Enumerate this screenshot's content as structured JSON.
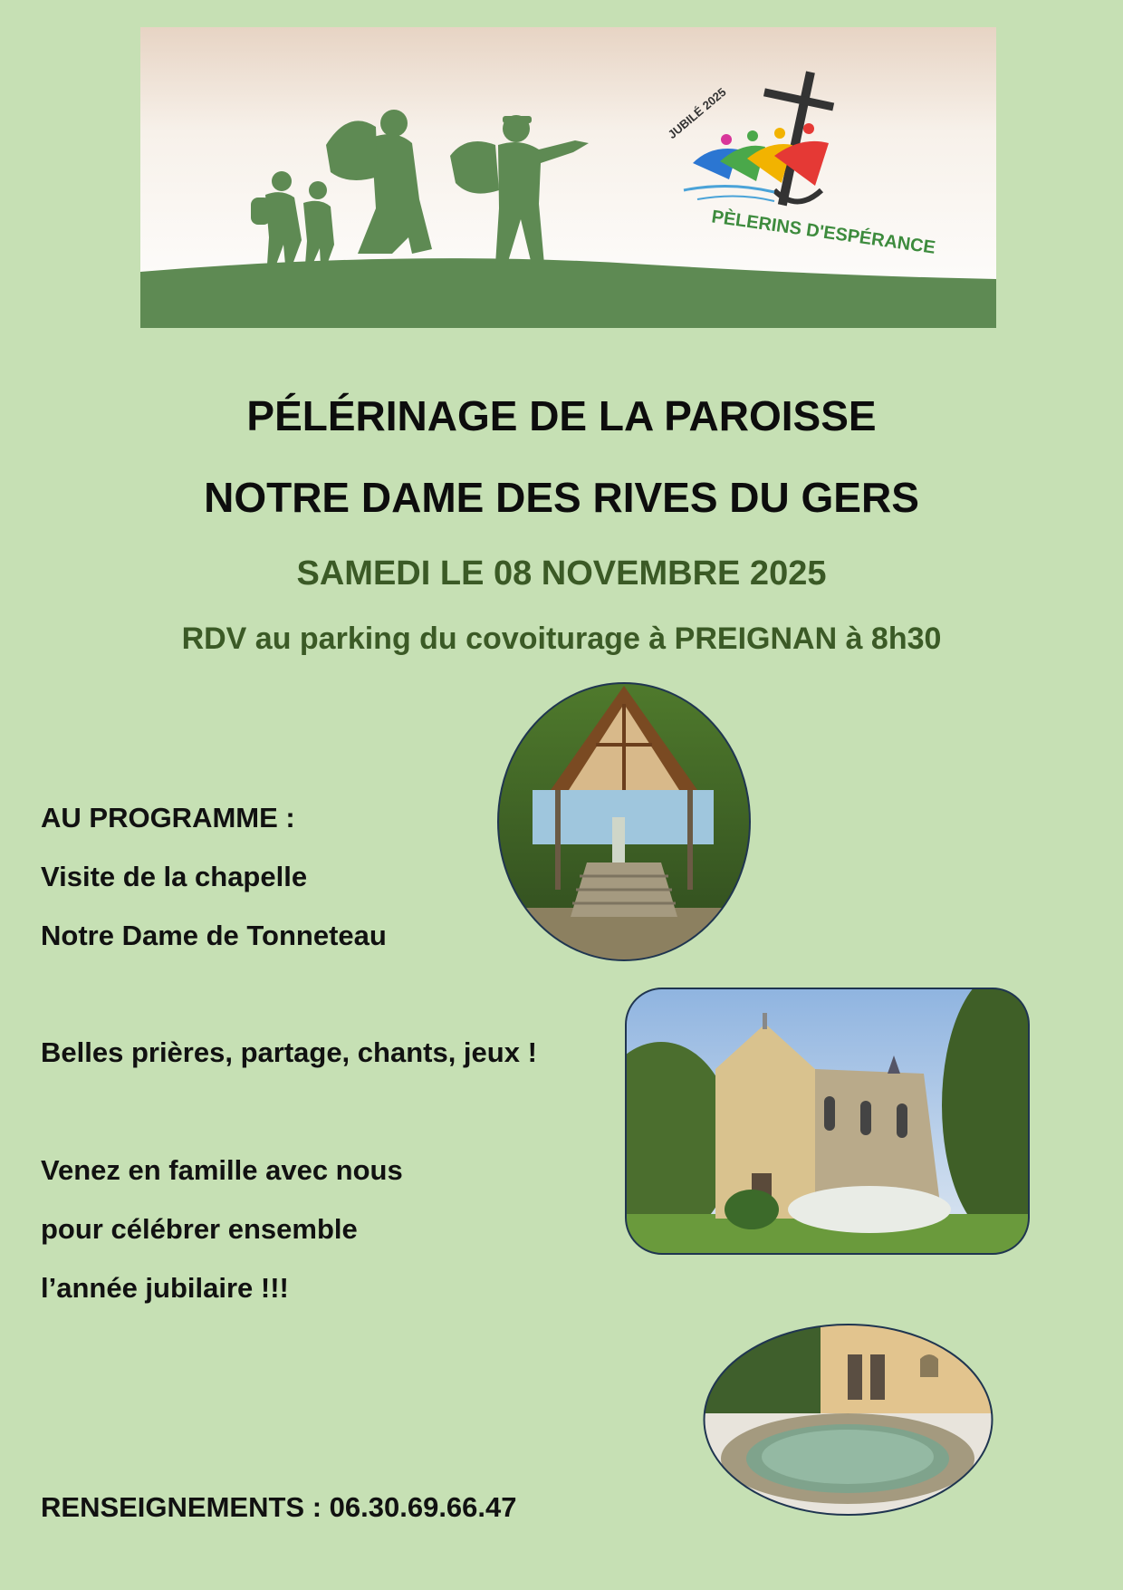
{
  "banner": {
    "logo_arc_top": "JUBILÉ 2025",
    "logo_arc_bottom": "PÈLERINS D'ESPÉRANCE"
  },
  "heading": {
    "line1": "PÉLÉRINAGE DE LA PAROISSE",
    "line2": "NOTRE DAME DES RIVES DU GERS"
  },
  "date": "SAMEDI LE 08 NOVEMBRE 2025",
  "rdv": "RDV au parking du covoiturage à PREIGNAN à 8h30",
  "program": {
    "label": "AU PROGRAMME :",
    "line1": "Visite de la chapelle",
    "line2": "Notre Dame de Tonneteau"
  },
  "activities": "Belles prières, partage, chants, jeux !",
  "invite": {
    "line1": "Venez en famille avec nous",
    "line2": "pour célébrer ensemble",
    "line3": "l’année jubilaire !!!"
  },
  "contact": "RENSEIGNEMENTS : 06.30.69.66.47",
  "colors": {
    "background": "#c6e0b4",
    "silhouette_green": "#5e8a53",
    "subtitle_green": "#3b5a26"
  }
}
